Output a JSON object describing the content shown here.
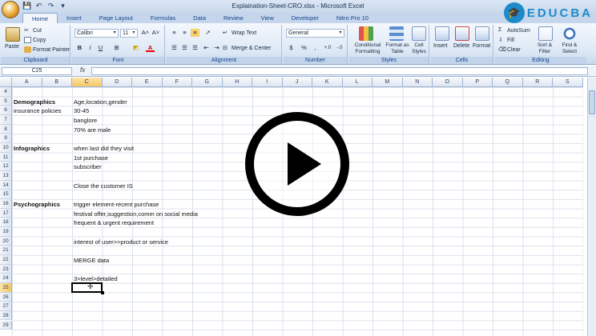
{
  "window": {
    "title": "Explaination-Sheet-CRO.xlsx - Microsoft Excel",
    "logo_text": "EDUCBA",
    "logo_glyph": "🎓"
  },
  "qat": [
    "💾",
    "↶",
    "↷",
    "▾"
  ],
  "tabs": [
    "Home",
    "Insert",
    "Page Layout",
    "Formulas",
    "Data",
    "Review",
    "View",
    "Developer",
    "Nitro Pro 10"
  ],
  "ribbon": {
    "clipboard": {
      "paste": "Paste",
      "cut": "Cut",
      "copy": "Copy",
      "format_painter": "Format Painter",
      "label": "Clipboard"
    },
    "font": {
      "name": "Calibri",
      "size": "11",
      "grow": "A˄",
      "shrink": "A˅",
      "bold": "B",
      "italic": "I",
      "underline": "U",
      "border": "⊞",
      "fill": "◩",
      "color": "A",
      "label": "Font"
    },
    "alignment": {
      "wrap": "Wrap Text",
      "merge": "Merge & Center",
      "label": "Alignment"
    },
    "number": {
      "format": "General",
      "currency": "$",
      "percent": "%",
      "comma": ",",
      "inc": "+.0",
      "dec": "-.0",
      "label": "Number"
    },
    "styles": {
      "conditional": "Conditional Formatting",
      "format_table": "Format as Table",
      "cell_styles": "Cell Styles",
      "label": "Styles"
    },
    "cells": {
      "insert": "Insert",
      "delete": "Delete",
      "format": "Format",
      "label": "Cells"
    },
    "editing": {
      "autosum": "AutoSum",
      "fill": "Fill",
      "clear": "Clear",
      "sort": "Sort & Filter",
      "find": "Find & Select",
      "label": "Editing"
    }
  },
  "formula_bar": {
    "name_box": "C25",
    "fx": "fx",
    "value": ""
  },
  "columns": [
    "A",
    "B",
    "C",
    "D",
    "E",
    "F",
    "G",
    "H",
    "I",
    "J",
    "K",
    "L",
    "M",
    "N",
    "O",
    "P",
    "Q",
    "R",
    "S"
  ],
  "selected_column": "C",
  "rows": [
    "4",
    "5",
    "6",
    "7",
    "8",
    "9",
    "10",
    "11",
    "12",
    "13",
    "14",
    "15",
    "16",
    "17",
    "18",
    "19",
    "20",
    "21",
    "22",
    "23",
    "24",
    "25",
    "26",
    "27",
    "28",
    "29"
  ],
  "selected_row": "25",
  "cells": [
    {
      "ref": "A5",
      "text": "Demographics",
      "bold": true
    },
    {
      "ref": "C5",
      "text": "Age,location,gender"
    },
    {
      "ref": "A6",
      "text": "insurance policies"
    },
    {
      "ref": "C6",
      "text": "30-45"
    },
    {
      "ref": "C7",
      "text": "banglore"
    },
    {
      "ref": "C8",
      "text": "70% are male"
    },
    {
      "ref": "A10",
      "text": "Infographics",
      "bold": true
    },
    {
      "ref": "C10",
      "text": "when last did they visit"
    },
    {
      "ref": "C11",
      "text": "1st purchase"
    },
    {
      "ref": "C12",
      "text": "subscriber"
    },
    {
      "ref": "C14",
      "text": "Close the customer IS"
    },
    {
      "ref": "A16",
      "text": "Psychographics",
      "bold": true
    },
    {
      "ref": "C16",
      "text": "trigger element-recent purchase"
    },
    {
      "ref": "C17",
      "text": "festival offer,suggestion,comm on social media"
    },
    {
      "ref": "C18",
      "text": "frequent & urgent requirement"
    },
    {
      "ref": "C20",
      "text": "interest of user>>product or service"
    },
    {
      "ref": "C22",
      "text": "MERGE data"
    },
    {
      "ref": "C24",
      "text": "3>level>detailed"
    }
  ],
  "selected_cell": "C25"
}
